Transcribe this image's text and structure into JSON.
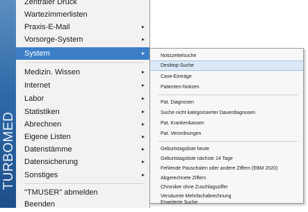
{
  "brand": {
    "text": "TURBOMED"
  },
  "main_menu": {
    "items": [
      {
        "label": "Zentraler Druck",
        "has_submenu": false
      },
      {
        "label": "Wartezimmerlisten",
        "has_submenu": false
      },
      {
        "label": "Praxis-E-Mail",
        "has_submenu": true
      },
      {
        "label": "Vorsorge-System",
        "has_submenu": true
      },
      {
        "label": "System",
        "has_submenu": true,
        "active": true
      },
      {
        "label": "Medizin. Wissen",
        "has_submenu": true
      },
      {
        "label": "Internet",
        "has_submenu": true
      },
      {
        "label": "Labor",
        "has_submenu": true
      },
      {
        "label": "Statistiken",
        "has_submenu": true
      },
      {
        "label": "Abrechnen",
        "has_submenu": true
      },
      {
        "label": "Eigene Listen",
        "has_submenu": true
      },
      {
        "label": "Datenstämme",
        "has_submenu": true
      },
      {
        "label": "Datensicherung",
        "has_submenu": true
      },
      {
        "label": "Sonstiges",
        "has_submenu": true
      },
      {
        "label": "\"TMUSER\" abmelden",
        "has_submenu": false
      },
      {
        "label": "Beenden",
        "has_submenu": false
      }
    ]
  },
  "sub_menu": {
    "items": [
      {
        "label": "Notizzettelsuche"
      },
      {
        "label": "Desktop-Suche",
        "hover": true
      },
      {
        "label": "Cave-Einträge"
      },
      {
        "label": "Patienten-Notizen"
      },
      {
        "label": "Pat. Diagnosen"
      },
      {
        "label": "Suche nicht kategorisierter Dauerdiagnosen"
      },
      {
        "label": "Pat. Krankenkassen"
      },
      {
        "label": "Pat. Verordnungen"
      },
      {
        "label": "Geburtstagsliste heute"
      },
      {
        "label": "Geburtstagsliste nächste 14 Tage"
      },
      {
        "label": "Fehlende Pauschalen oder andere Ziffern (EBM 2020)"
      },
      {
        "label": "Abgerechnete Ziffern"
      },
      {
        "label": "Chroniker ohne Zuschlagsziffer"
      },
      {
        "label": "Versäumte Mehrfachabrechnung"
      },
      {
        "label": "Erweiterte Suche"
      }
    ]
  },
  "colors": {
    "brand_strip": "#2f6aa8",
    "active_item": "#3c7fc7",
    "hover_item": "#dce8f7"
  }
}
